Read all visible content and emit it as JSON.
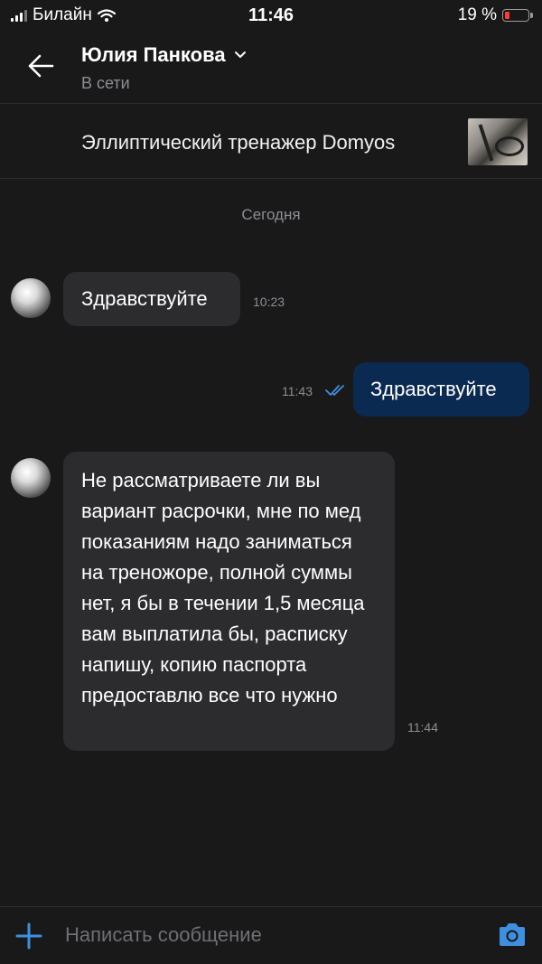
{
  "status_bar": {
    "carrier": "Билайн",
    "time": "11:46",
    "battery_percent": "19 %",
    "battery_level": 0.19
  },
  "header": {
    "contact_name": "Юлия Панкова",
    "status": "В сети"
  },
  "listing": {
    "title": "Эллиптический тренажер Domyos"
  },
  "date_separator": "Сегодня",
  "messages": [
    {
      "direction": "in",
      "text": "Здравствуйте",
      "time": "10:23"
    },
    {
      "direction": "out",
      "text": "Здравствуйте",
      "time": "11:43",
      "read": true
    },
    {
      "direction": "in",
      "text": "Не рассматриваете ли вы вариант расрочки, мне по мед показаниям надо заниматься на треножоре, полной суммы нет, я бы в течении 1,5 месяца вам выплатила бы, расписку напишу, копию паспорта предоставлю все что нужно",
      "time": "11:44"
    }
  ],
  "composer": {
    "placeholder": "Написать сообщение"
  },
  "colors": {
    "background": "#19191a",
    "incoming_bubble": "#2c2c2e",
    "outgoing_bubble": "#0b2a52",
    "accent": "#3f8fe0"
  }
}
